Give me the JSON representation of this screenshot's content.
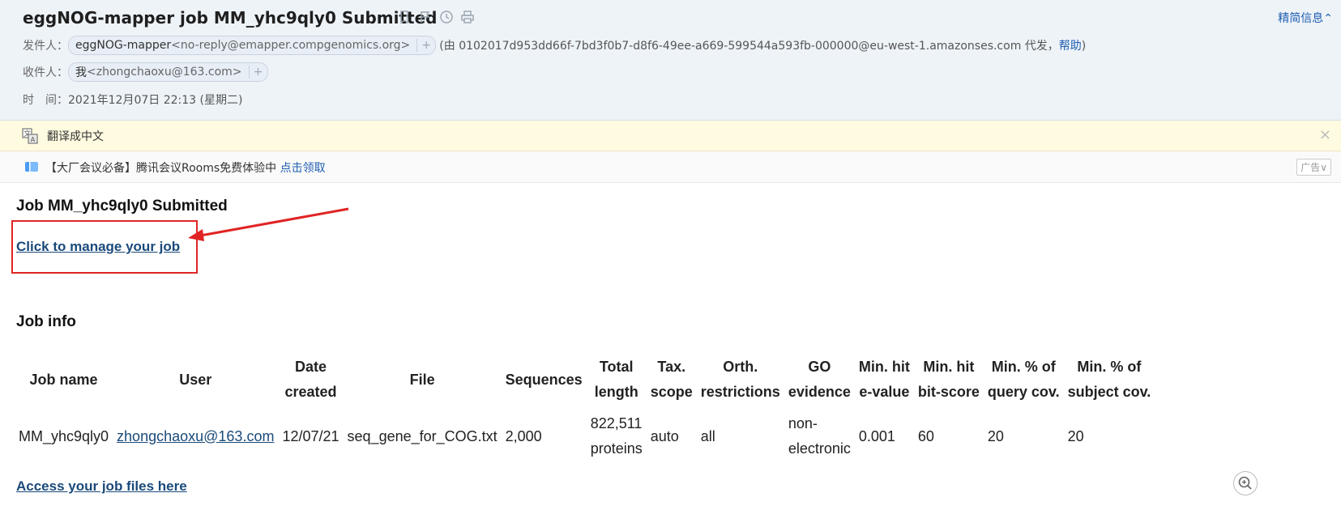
{
  "header": {
    "subject": "eggNOG-mapper job MM_yhc9qly0 Submitted",
    "brief_toggle": "精简信息",
    "sender": {
      "label": "发件人：",
      "name": "eggNOG-mapper",
      "address": "<no-reply@emapper.compgenomics.org>",
      "plus": "+",
      "via_text": "(由 0102017d953dd66f-7bd3f0b7-d8f6-49ee-a669-599544a593fb-000000@eu-west-1.amazonses.com 代发，",
      "help": "帮助",
      "via_close": ")"
    },
    "recipient": {
      "label": "收件人：",
      "name": "我",
      "address": "<zhongchaoxu@163.com>",
      "plus": "+"
    },
    "time": {
      "label": "时　间：",
      "value": "2021年12月07日 22:13 (星期二)"
    }
  },
  "translate_bar": {
    "label": "翻译成中文",
    "close": "×"
  },
  "ad_bar": {
    "text": "【大厂会议必备】腾讯会议Rooms免费体验中",
    "link": "点击领取",
    "badge": "广告∨"
  },
  "body": {
    "job_title": "Job MM_yhc9qly0 Submitted",
    "manage_link": "Click to manage your job",
    "section_title": "Job info",
    "access_link": "Access your job files here"
  },
  "table": {
    "headers": [
      [
        "Job name",
        ""
      ],
      [
        "User",
        ""
      ],
      [
        "Date",
        "created"
      ],
      [
        "File",
        ""
      ],
      [
        "Sequences",
        ""
      ],
      [
        "Total",
        "length"
      ],
      [
        "Tax.",
        "scope"
      ],
      [
        "Orth.",
        "restrictions"
      ],
      [
        "GO",
        "evidence"
      ],
      [
        "Min. hit",
        "e-value"
      ],
      [
        "Min. hit",
        "bit-score"
      ],
      [
        "Min. % of",
        "query cov."
      ],
      [
        "Min. % of",
        "subject cov."
      ]
    ],
    "row": {
      "job_name": "MM_yhc9qly0",
      "user": "zhongchaoxu@163.com",
      "date": "12/07/21",
      "file": "seq_gene_for_COG.txt",
      "sequences": "2,000",
      "total_length_1": "822,511",
      "total_length_2": "proteins",
      "tax_scope": "auto",
      "orth": "all",
      "go_1": "non-",
      "go_2": "electronic",
      "evalue": "0.001",
      "bitscore": "60",
      "query_cov": "20",
      "subject_cov": "20"
    }
  },
  "colors": {
    "header_bg": "#eef3f8",
    "link": "#1a4a7a",
    "annotation_red": "#e02424"
  }
}
